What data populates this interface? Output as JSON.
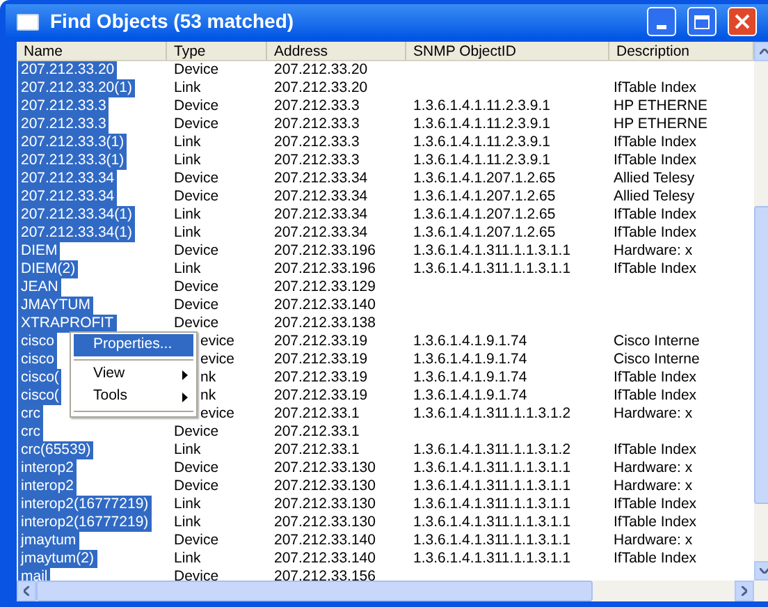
{
  "window": {
    "title": "Find Objects (53 matched)"
  },
  "table": {
    "columns": [
      "Name",
      "Type",
      "Address",
      "SNMP ObjectID",
      "Description"
    ],
    "rows": [
      {
        "name": "207.212.33.20",
        "type": "Device",
        "address": "207.212.33.20",
        "oid": "",
        "description": "",
        "selected": true
      },
      {
        "name": "207.212.33.20(1)",
        "type": "Link",
        "address": "207.212.33.20",
        "oid": "",
        "description": "IfTable Index",
        "selected": true
      },
      {
        "name": "207.212.33.3",
        "type": "Device",
        "address": "207.212.33.3",
        "oid": "1.3.6.1.4.1.11.2.3.9.1",
        "description": "HP ETHERNE",
        "selected": true
      },
      {
        "name": "207.212.33.3",
        "type": "Device",
        "address": "207.212.33.3",
        "oid": "1.3.6.1.4.1.11.2.3.9.1",
        "description": "HP ETHERNE",
        "selected": true
      },
      {
        "name": "207.212.33.3(1)",
        "type": "Link",
        "address": "207.212.33.3",
        "oid": "1.3.6.1.4.1.11.2.3.9.1",
        "description": "IfTable Index",
        "selected": true
      },
      {
        "name": "207.212.33.3(1)",
        "type": "Link",
        "address": "207.212.33.3",
        "oid": "1.3.6.1.4.1.11.2.3.9.1",
        "description": "IfTable Index",
        "selected": true
      },
      {
        "name": "207.212.33.34",
        "type": "Device",
        "address": "207.212.33.34",
        "oid": "1.3.6.1.4.1.207.1.2.65",
        "description": "Allied Telesy",
        "selected": true
      },
      {
        "name": "207.212.33.34",
        "type": "Device",
        "address": "207.212.33.34",
        "oid": "1.3.6.1.4.1.207.1.2.65",
        "description": "Allied Telesy",
        "selected": true
      },
      {
        "name": "207.212.33.34(1)",
        "type": "Link",
        "address": "207.212.33.34",
        "oid": "1.3.6.1.4.1.207.1.2.65",
        "description": "IfTable Index",
        "selected": true
      },
      {
        "name": "207.212.33.34(1)",
        "type": "Link",
        "address": "207.212.33.34",
        "oid": "1.3.6.1.4.1.207.1.2.65",
        "description": "IfTable Index",
        "selected": true
      },
      {
        "name": "DIEM",
        "type": "Device",
        "address": "207.212.33.196",
        "oid": "1.3.6.1.4.1.311.1.1.3.1.1",
        "description": "Hardware: x",
        "selected": true
      },
      {
        "name": "DIEM(2)",
        "type": "Link",
        "address": "207.212.33.196",
        "oid": "1.3.6.1.4.1.311.1.1.3.1.1",
        "description": "IfTable Index",
        "selected": true
      },
      {
        "name": "JEAN",
        "type": "Device",
        "address": "207.212.33.129",
        "oid": "",
        "description": "",
        "selected": true
      },
      {
        "name": "JMAYTUM",
        "type": "Device",
        "address": "207.212.33.140",
        "oid": "",
        "description": "",
        "selected": true
      },
      {
        "name": "XTRAPROFIT",
        "type": "Device",
        "address": "207.212.33.138",
        "oid": "",
        "description": "",
        "selected": true
      },
      {
        "name": "cisco",
        "type": "evice",
        "covered": true,
        "address": "207.212.33.19",
        "oid": "1.3.6.1.4.1.9.1.74",
        "description": "Cisco Interne",
        "selected": true
      },
      {
        "name": "cisco",
        "type": "evice",
        "covered": true,
        "address": "207.212.33.19",
        "oid": "1.3.6.1.4.1.9.1.74",
        "description": "Cisco Interne",
        "selected": true
      },
      {
        "name": "cisco(",
        "type": "nk",
        "covered": true,
        "address": "207.212.33.19",
        "oid": "1.3.6.1.4.1.9.1.74",
        "description": "IfTable Index",
        "selected": true
      },
      {
        "name": "cisco(",
        "type": "nk",
        "covered": true,
        "address": "207.212.33.19",
        "oid": "1.3.6.1.4.1.9.1.74",
        "description": "IfTable Index",
        "selected": true
      },
      {
        "name": "crc",
        "type": "evice",
        "covered": true,
        "address": "207.212.33.1",
        "oid": "1.3.6.1.4.1.311.1.1.3.1.2",
        "description": "Hardware: x",
        "selected": true
      },
      {
        "name": "crc",
        "type": "Device",
        "address": "207.212.33.1",
        "oid": "",
        "description": "",
        "selected": true
      },
      {
        "name": "crc(65539)",
        "type": "Link",
        "address": "207.212.33.1",
        "oid": "1.3.6.1.4.1.311.1.1.3.1.2",
        "description": "IfTable Index",
        "selected": true
      },
      {
        "name": "interop2",
        "type": "Device",
        "address": "207.212.33.130",
        "oid": "1.3.6.1.4.1.311.1.1.3.1.1",
        "description": "Hardware: x",
        "selected": true
      },
      {
        "name": "interop2",
        "type": "Device",
        "address": "207.212.33.130",
        "oid": "1.3.6.1.4.1.311.1.1.3.1.1",
        "description": "Hardware: x",
        "selected": true
      },
      {
        "name": "interop2(16777219)",
        "type": "Link",
        "address": "207.212.33.130",
        "oid": "1.3.6.1.4.1.311.1.1.3.1.1",
        "description": "IfTable Index",
        "selected": true
      },
      {
        "name": "interop2(16777219)",
        "type": "Link",
        "address": "207.212.33.130",
        "oid": "1.3.6.1.4.1.311.1.1.3.1.1",
        "description": "IfTable Index",
        "selected": true
      },
      {
        "name": "jmaytum",
        "type": "Device",
        "address": "207.212.33.140",
        "oid": "1.3.6.1.4.1.311.1.1.3.1.1",
        "description": "Hardware: x",
        "selected": true
      },
      {
        "name": "jmaytum(2)",
        "type": "Link",
        "address": "207.212.33.140",
        "oid": "1.3.6.1.4.1.311.1.1.3.1.1",
        "description": "IfTable Index",
        "selected": true
      },
      {
        "name": "mail",
        "type": "Device",
        "address": "207.212.33.156",
        "oid": "",
        "description": "",
        "selected": true
      }
    ]
  },
  "context_menu": {
    "items": [
      {
        "kind": "item",
        "label": "Properties...",
        "selected": true
      },
      {
        "kind": "separator"
      },
      {
        "kind": "submenu",
        "label": "View",
        "selected": false
      },
      {
        "kind": "submenu",
        "label": "Tools",
        "selected": false
      },
      {
        "kind": "separator"
      }
    ]
  }
}
